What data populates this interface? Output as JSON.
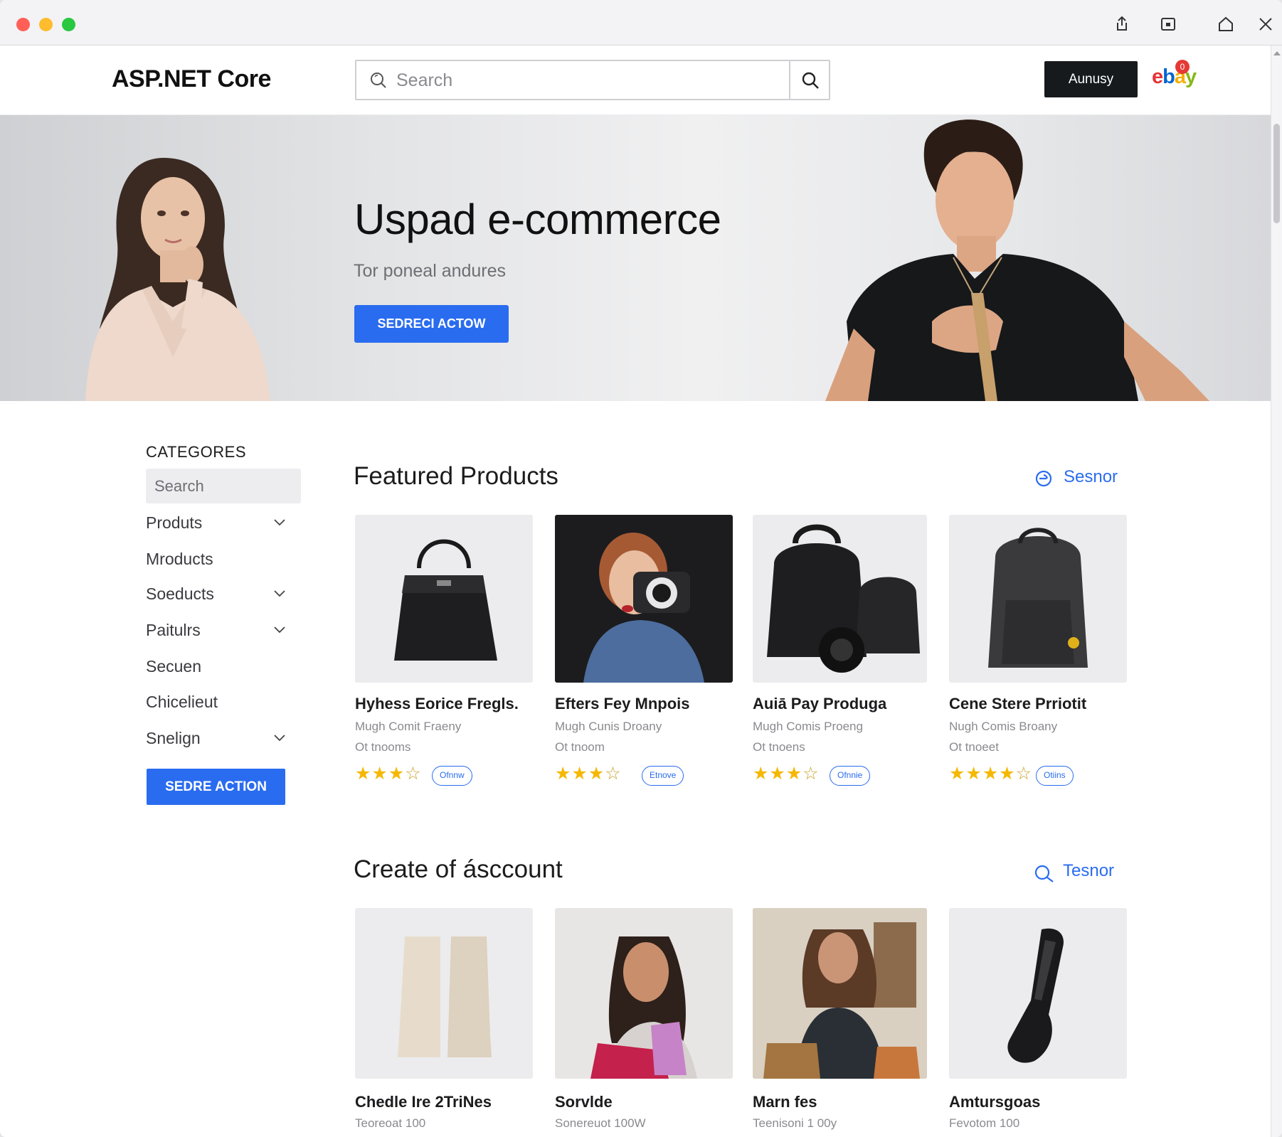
{
  "window": {
    "controls": [
      "close",
      "minimize",
      "zoom"
    ],
    "toolbar_icons": [
      "share-icon",
      "tab-icon",
      "home-icon",
      "close-icon"
    ]
  },
  "header": {
    "logo": "ASP.NET Core",
    "search_placeholder": "Search",
    "account_button": "Aunusy",
    "ebay": {
      "e": "e",
      "b": "b",
      "a": "a",
      "y": "y"
    },
    "cart_badge": "0"
  },
  "hero": {
    "title": "Uspad e-commerce",
    "subtitle": "Tor poneal andures",
    "button": "SEDRECI ACTOW"
  },
  "sidebar": {
    "title": "CATEGORES",
    "search_placeholder": "Search",
    "items": [
      {
        "label": "Produts",
        "has_chevron": true
      },
      {
        "label": "Mroducts",
        "has_chevron": false
      },
      {
        "label": "Soeducts",
        "has_chevron": true
      },
      {
        "label": "Paitulrs",
        "has_chevron": true
      },
      {
        "label": "Secuen",
        "has_chevron": false
      },
      {
        "label": "Chicelieut",
        "has_chevron": false
      },
      {
        "label": "Snelign",
        "has_chevron": true
      }
    ],
    "button": "SEDRE ACTION"
  },
  "featured": {
    "title": "Featured Products",
    "link": "Sesnor",
    "products": [
      {
        "name": "Hyhess Eorice Fregls.",
        "meta1": "Mugh Comit Fraeny",
        "meta2": "Ot tnooms",
        "rating": 3.5,
        "pill": "Ofnnw"
      },
      {
        "name": "Efters Fey Mnpois",
        "meta1": "Mugh Cunis Droany",
        "meta2": "Ot tnoom",
        "rating": 3.5,
        "pill": "Etnove"
      },
      {
        "name": "Auiā Pay Produga",
        "meta1": "Mugh Comis Proeng",
        "meta2": "Ot tnoens",
        "rating": 3.5,
        "pill": "Ofnnie"
      },
      {
        "name": "Cene Stere Prriotit",
        "meta1": "Nugh Comis Broany",
        "meta2": "Ot tnoeet",
        "rating": 3.5,
        "pill": "Otiins"
      }
    ]
  },
  "account": {
    "title": "Create of ásccount",
    "link": "Tesnor",
    "products": [
      {
        "name": "Chedle Ire 2TriNes",
        "meta1": "Teoreoat 100"
      },
      {
        "name": "Sorvlde",
        "meta1": "Sonereuot 100W"
      },
      {
        "name": "Marn fes",
        "meta1": "Teenisoni 1 00y"
      },
      {
        "name": "Amtursgoas",
        "meta1": "Fevotom 100"
      }
    ]
  },
  "colors": {
    "accent": "#2a6cf0",
    "dark_button": "#161a1d",
    "star": "#f5b800",
    "ebay_e": "#e53238",
    "ebay_b": "#0064d2",
    "ebay_a": "#f5af02",
    "ebay_y": "#86b817"
  }
}
